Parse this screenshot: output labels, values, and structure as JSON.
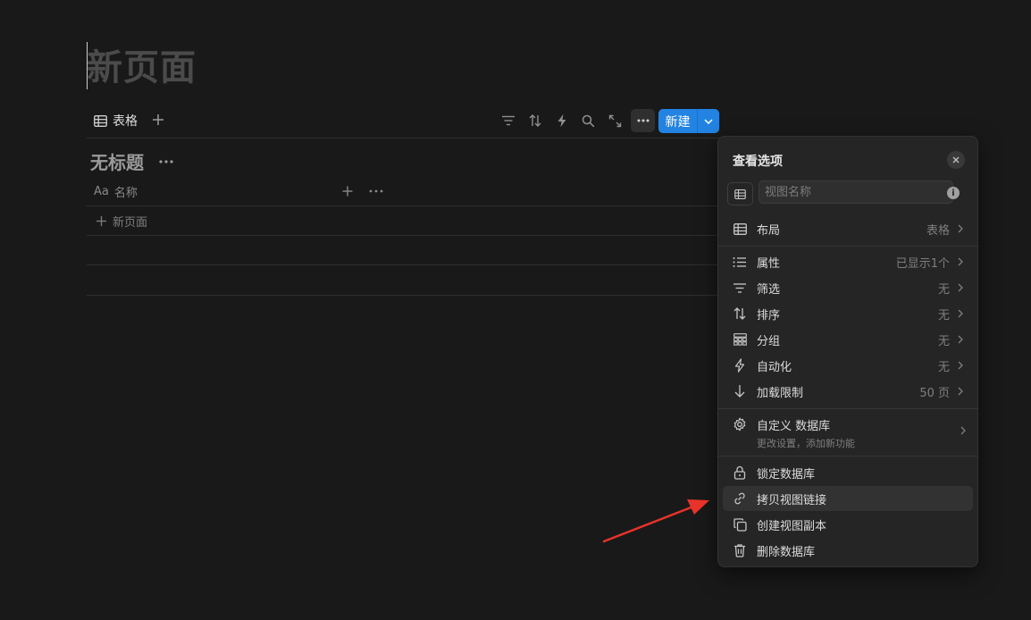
{
  "page": {
    "title": "新页面"
  },
  "views": {
    "tab_label": "表格"
  },
  "toolbar": {
    "icons": [
      "filter-icon",
      "sort-icon",
      "lightning-icon",
      "search-icon",
      "expand-icon",
      "more-icon"
    ],
    "new_label": "新建",
    "accent": "#2383e2"
  },
  "database": {
    "title": "无标题",
    "column_prefix": "Aa",
    "column_name": "名称",
    "new_row_label": "新页面"
  },
  "menu": {
    "title": "查看选项",
    "view_name_placeholder": "视图名称",
    "layout": {
      "label": "布局",
      "value": "表格"
    },
    "items": [
      {
        "label": "属性",
        "value": "已显示1个"
      },
      {
        "label": "筛选",
        "value": "无"
      },
      {
        "label": "排序",
        "value": "无"
      },
      {
        "label": "分组",
        "value": "无"
      },
      {
        "label": "自动化",
        "value": "无"
      },
      {
        "label": "加载限制",
        "value": "50 页"
      }
    ],
    "customize": {
      "label": "自定义 数据库",
      "sub": "更改设置，添加新功能"
    },
    "actions": [
      {
        "label": "锁定数据库"
      },
      {
        "label": "拷贝视图链接"
      },
      {
        "label": "创建视图副本"
      },
      {
        "label": "删除数据库"
      }
    ]
  },
  "annotation": {
    "color": "#e8332a"
  }
}
